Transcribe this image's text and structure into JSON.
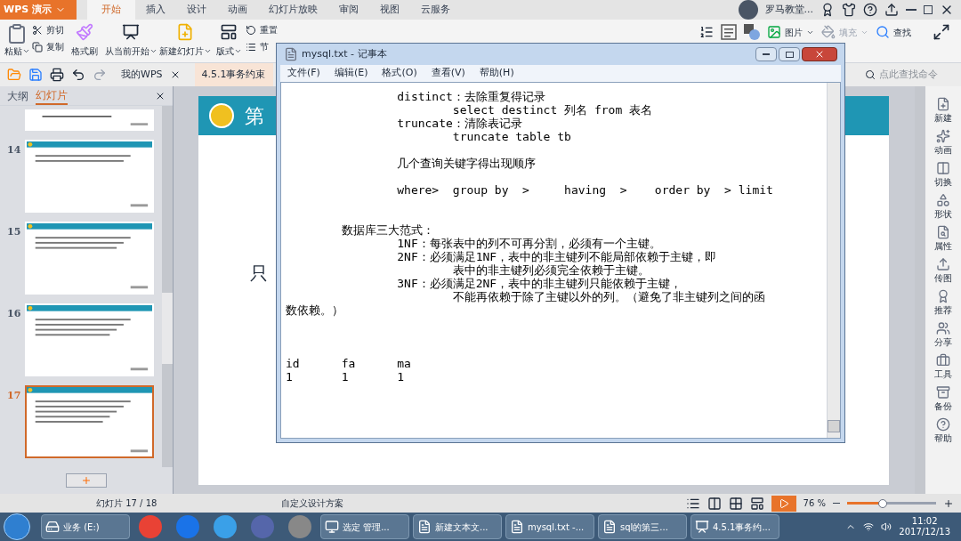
{
  "app_menu": {
    "label": "WPS 演示"
  },
  "ribbon_tabs": [
    {
      "label": "开始",
      "selected": true
    },
    {
      "label": "插入",
      "selected": false
    },
    {
      "label": "设计",
      "selected": false
    },
    {
      "label": "动画",
      "selected": false
    },
    {
      "label": "幻灯片放映",
      "selected": false
    },
    {
      "label": "审阅",
      "selected": false
    },
    {
      "label": "视图",
      "selected": false
    },
    {
      "label": "云服务",
      "selected": false
    }
  ],
  "user": {
    "name": "罗马教堂..."
  },
  "ribbon": {
    "paste": "粘贴",
    "cut": "剪切",
    "copy": "复制",
    "format_painter": "格式刷",
    "from_current": "从当前开始",
    "new_slide": "新建幻灯片",
    "layout": "版式",
    "reset": "重置",
    "section": "节",
    "picture": "图片",
    "fill": {
      "label": "填充",
      "disabled": true
    },
    "find": "查找"
  },
  "doc_tabs": [
    {
      "label": "我的WPS",
      "selected": false
    },
    {
      "label": "4.5.1事务约束",
      "selected": true
    }
  ],
  "command_search": {
    "placeholder": "点此查找命令"
  },
  "slide_panel": {
    "tabs": [
      {
        "label": "大纲",
        "selected": false
      },
      {
        "label": "幻灯片",
        "selected": true
      }
    ],
    "thumbnails": [
      {
        "selected": false
      },
      {
        "number": "14",
        "selected": false
      },
      {
        "number": "15",
        "selected": false
      },
      {
        "number": "16",
        "selected": false
      },
      {
        "number": "17",
        "selected": true
      }
    ]
  },
  "slide": {
    "title": "第",
    "body": "只"
  },
  "notepad": {
    "title": "mysql.txt - 记事本",
    "menu": [
      "文件(F)",
      "编辑(E)",
      "格式(O)",
      "查看(V)",
      "帮助(H)"
    ],
    "blocks": [
      [
        "\t\tdistinct：去除重复得记录",
        "\t\t\tselect destinct 列名 from 表名",
        "\t\ttruncate：清除表记录",
        "\t\t\ttruncate table tb"
      ],
      [
        "\t\t几个查询关键字得出现顺序"
      ],
      [
        "\t\twhere>\tgroup by  >\thaving  >    order by  > limit"
      ],
      [
        "\t数据库三大范式：",
        "\t\t1NF：每张表中的列不可再分割，必须有一个主键。",
        "\t\t2NF：必须满足1NF，表中的非主键列不能局部依赖于主键，即",
        "\t\t\t表中的非主键列必须完全依赖于主键。",
        "\t\t3NF：必须满足2NF，表中的非主键列只能依赖于主键，",
        "\t\t\t不能再依赖于除了主键以外的列。（避免了非主键列之间的函",
        "数依赖。）"
      ],
      [
        "id\tfa\tma",
        "1\t1\t1"
      ]
    ]
  },
  "side_tools": [
    "新建",
    "动画",
    "切换",
    "形状",
    "属性",
    "传图",
    "推荐",
    "分享",
    "工具",
    "备份",
    "帮助"
  ],
  "status_bar": {
    "slide_count": "幻灯片 17 / 18",
    "theme": "自定义设计方案",
    "zoom": "76 %",
    "zoom_slider": {
      "level": 0.4
    }
  },
  "taskbar": {
    "items": [
      {
        "label": "业务 (E:)"
      },
      {
        "label": "选定 管理..."
      },
      {
        "label": "新建文本文..."
      },
      {
        "label": "mysql.txt -..."
      },
      {
        "label": "sql的第三..."
      },
      {
        "label": "4.5.1事务约..."
      }
    ]
  },
  "clock": {
    "time": "11:02",
    "date": "2017/12/13"
  }
}
